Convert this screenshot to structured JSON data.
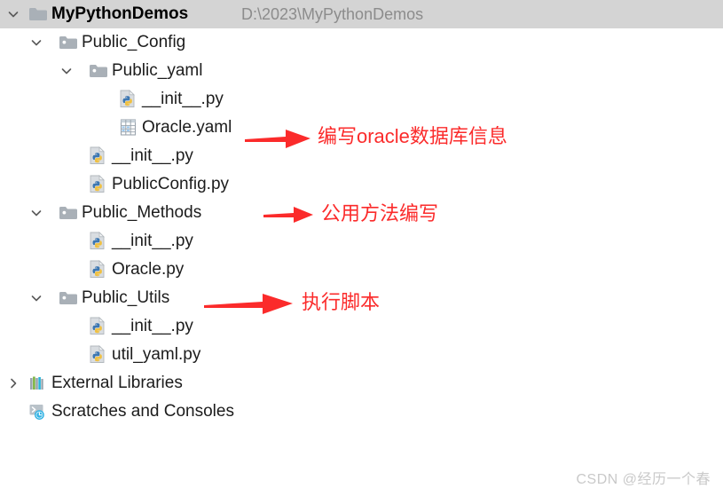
{
  "window": {
    "title": "MyPythonDemos",
    "root_path": "D:\\2023\\MyPythonDemos"
  },
  "tree": {
    "nodes": [
      {
        "id": "root-mypythondemos",
        "label": "MyPythonDemos",
        "secondary": "D:\\2023\\MyPythonDemos",
        "icon": "folder-plain-icon",
        "expander": "chevron-down-icon",
        "depth": 0,
        "selected": true,
        "bold": true
      },
      {
        "id": "public-config",
        "label": "Public_Config",
        "icon": "folder-module-icon",
        "expander": "chevron-down-icon",
        "depth": 1,
        "selected": false,
        "bold": false
      },
      {
        "id": "public-yaml",
        "label": "Public_yaml",
        "icon": "folder-module-icon",
        "expander": "chevron-down-icon",
        "depth": 2,
        "selected": false,
        "bold": false
      },
      {
        "id": "public-yaml-init",
        "label": "__init__.py",
        "icon": "python-file-icon",
        "expander": "none",
        "depth": 3,
        "selected": false,
        "bold": false
      },
      {
        "id": "oracle-yaml",
        "label": "Oracle.yaml",
        "icon": "yaml-file-icon",
        "expander": "none",
        "depth": 3,
        "selected": false,
        "bold": false
      },
      {
        "id": "public-config-init",
        "label": "__init__.py",
        "icon": "python-file-icon",
        "expander": "none",
        "depth": 2,
        "selected": false,
        "bold": false
      },
      {
        "id": "publicconfig-py",
        "label": "PublicConfig.py",
        "icon": "python-file-icon",
        "expander": "none",
        "depth": 2,
        "selected": false,
        "bold": false
      },
      {
        "id": "public-methods",
        "label": "Public_Methods",
        "icon": "folder-module-icon",
        "expander": "chevron-down-icon",
        "depth": 1,
        "selected": false,
        "bold": false
      },
      {
        "id": "public-methods-init",
        "label": "__init__.py",
        "icon": "python-file-icon",
        "expander": "none",
        "depth": 2,
        "selected": false,
        "bold": false
      },
      {
        "id": "oracle-py",
        "label": "Oracle.py",
        "icon": "python-file-icon",
        "expander": "none",
        "depth": 2,
        "selected": false,
        "bold": false
      },
      {
        "id": "public-utils",
        "label": "Public_Utils",
        "icon": "folder-module-icon",
        "expander": "chevron-down-icon",
        "depth": 1,
        "selected": false,
        "bold": false
      },
      {
        "id": "public-utils-init",
        "label": "__init__.py",
        "icon": "python-file-icon",
        "expander": "none",
        "depth": 2,
        "selected": false,
        "bold": false
      },
      {
        "id": "util-yaml-py",
        "label": "util_yaml.py",
        "icon": "python-file-icon",
        "expander": "none",
        "depth": 2,
        "selected": false,
        "bold": false
      },
      {
        "id": "external-libraries",
        "label": "External Libraries",
        "icon": "books-icon",
        "expander": "chevron-right-icon",
        "depth": 0,
        "selected": false,
        "bold": false
      },
      {
        "id": "scratches-and-consoles",
        "label": "Scratches and Consoles",
        "icon": "scratches-icon",
        "expander": "none",
        "depth": 0,
        "selected": false,
        "bold": false
      }
    ]
  },
  "annotations": {
    "color": "#fb2b2b",
    "items": [
      {
        "id": "anno-oracle-yaml",
        "text": "编写oracle数据库信息",
        "arrow": "arrow-right-icon"
      },
      {
        "id": "anno-publicconfig",
        "text": "公用方法编写",
        "arrow": "arrow-right-icon"
      },
      {
        "id": "anno-oracle-py",
        "text": "执行脚本",
        "arrow": "arrow-right-icon"
      }
    ]
  },
  "watermark": {
    "text": "CSDN @经历一个春"
  }
}
